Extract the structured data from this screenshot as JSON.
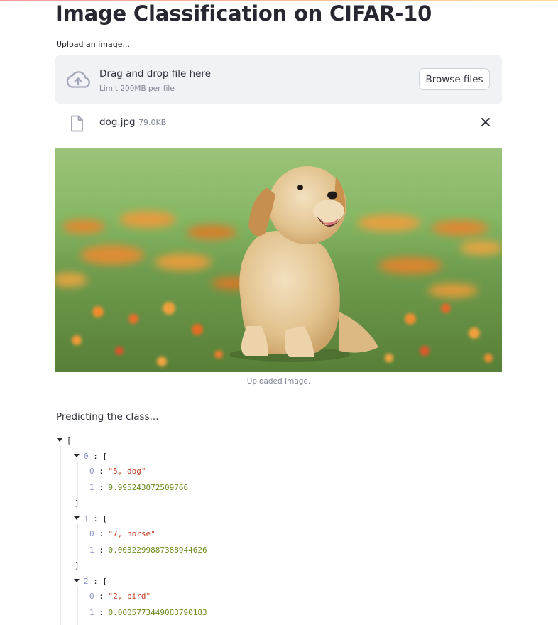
{
  "title": "Image Classification on CIFAR-10",
  "uploader": {
    "label": "Upload an image...",
    "drag_text": "Drag and drop file here",
    "limit_text": "Limit 200MB per file",
    "browse_label": "Browse files",
    "icon": "cloud-upload-icon"
  },
  "file": {
    "name": "dog.jpg",
    "size": "79.0KB",
    "icon": "file-icon"
  },
  "image": {
    "caption": "Uploaded Image."
  },
  "predict_text": "Predicting the class...",
  "json_view": {
    "open_bracket": "[",
    "close_bracket": "]",
    "colon": ":",
    "items": [
      {
        "index": "0",
        "label_index": "0",
        "label": "\"5, dog\"",
        "score_index": "1",
        "score": "9.995243072509766"
      },
      {
        "index": "1",
        "label_index": "0",
        "label": "\"7, horse\"",
        "score_index": "1",
        "score": "0.0032299887388944626"
      },
      {
        "index": "2",
        "label_index": "0",
        "label": "\"2, bird\"",
        "score_index": "1",
        "score": "0.0005773449083790183"
      }
    ]
  },
  "colors": {
    "accent": "#ff4b4b",
    "index": "#8c91c4",
    "string": "#c33c22",
    "number": "#6a8a1e"
  }
}
